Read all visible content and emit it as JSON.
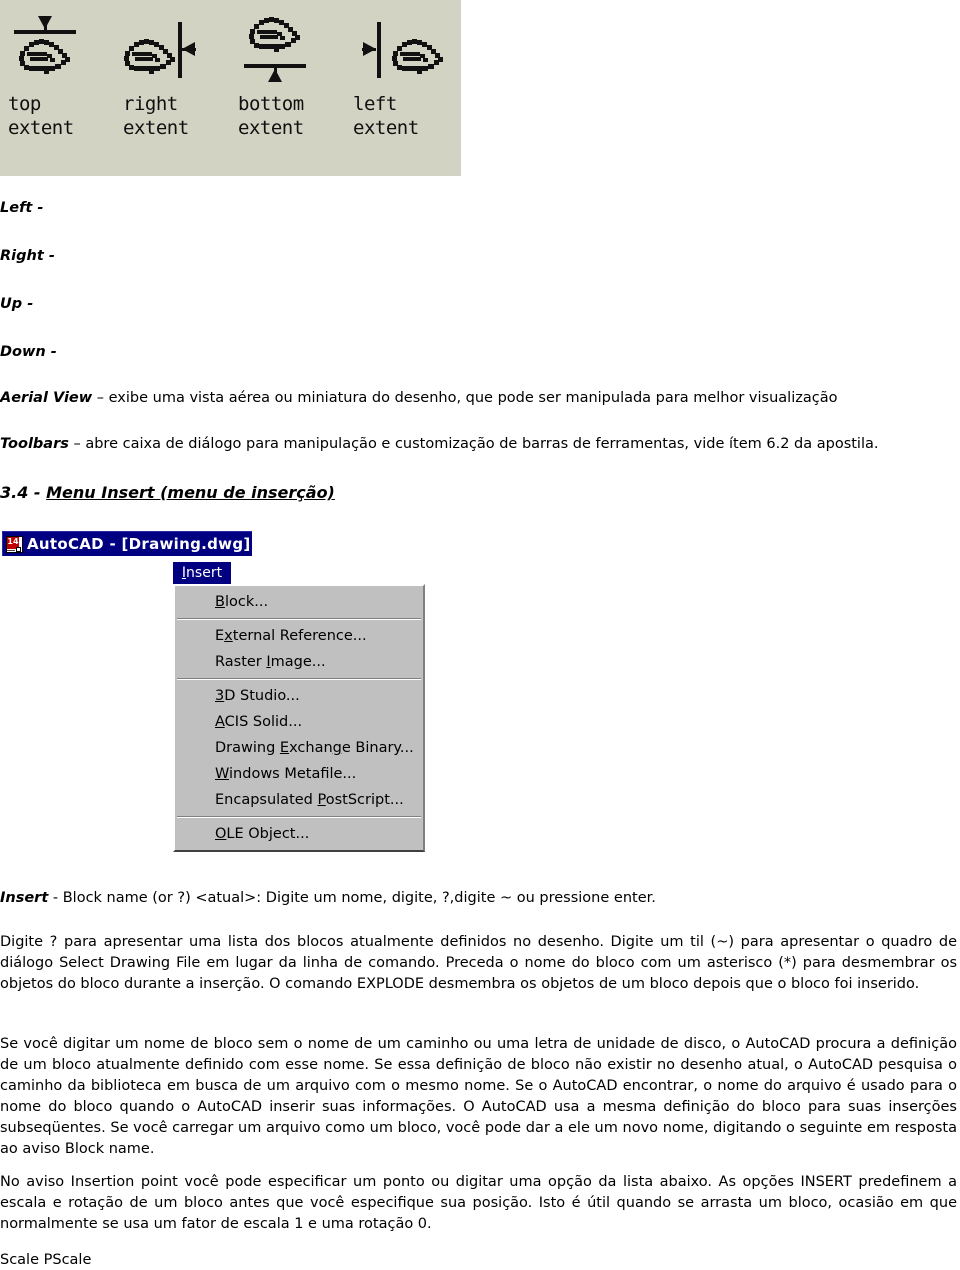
{
  "toolbar_image": {
    "name": "aerial-view-toolbar",
    "background": "#d3d3c4",
    "buttons": [
      {
        "icon": "hand-top-extent-icon",
        "label_line1": "top",
        "label_line2": "extent"
      },
      {
        "icon": "hand-right-extent-icon",
        "label_line1": "right",
        "label_line2": "extent"
      },
      {
        "icon": "hand-bottom-extent-icon",
        "label_line1": "bottom",
        "label_line2": "extent"
      },
      {
        "icon": "hand-left-extent-icon",
        "label_line1": "left",
        "label_line2": "extent"
      }
    ]
  },
  "definitions": [
    {
      "term": "Left",
      "dash": "-",
      "body": ""
    },
    {
      "term": "Right",
      "dash": "-",
      "body": ""
    },
    {
      "term": "Up",
      "dash": "-",
      "body": ""
    },
    {
      "term": "Down",
      "dash": "-",
      "body": ""
    }
  ],
  "paragraphs": {
    "aerial_view_term": "Aerial View",
    "aerial_view_body": " – exibe uma vista aérea ou miniatura do desenho, que pode ser manipulada para melhor visualização",
    "toolbars_term": "Toolbars",
    "toolbars_body": " – abre caixa de diálogo para manipulação e customização de barras de ferramentas, vide ítem 6.2 da apostila.",
    "insert_term": "Insert",
    "insert_body": " - Block name (or ?) <atual>: Digite um nome, digite, ?,digite ~ ou pressione enter.",
    "digite_para": "Digite ? para apresentar uma lista dos blocos atualmente definidos no desenho. Digite um til (~) para apresentar o quadro de diálogo Select Drawing File em lugar da linha de comando. Preceda o nome do bloco com um asterisco (*) para desmembrar os objetos do bloco durante a inserção. O comando EXPLODE desmembra os objetos de um bloco depois que o bloco foi inserido.",
    "se_voce_para": "Se você digitar um nome de bloco sem o nome de um caminho ou uma letra de unidade de disco, o AutoCAD procura a definição de um bloco atualmente definido com esse nome. Se essa definição de bloco não existir no desenho atual, o AutoCAD pesquisa o caminho da biblioteca em busca de um arquivo com o mesmo nome. Se o AutoCAD encontrar, o nome do arquivo é usado para o nome do bloco quando o AutoCAD inserir suas informações. O AutoCAD usa a mesma definição do bloco para suas inserções subseqüentes. Se você carregar um arquivo como um bloco, você pode dar a ele um novo nome, digitando o seguinte em resposta ao aviso Block name.",
    "no_aviso_para": "No aviso Insertion point você pode especificar um ponto ou digitar uma opção da lista abaixo. As opções INSERT predefinem a escala e rotação de um bloco antes que você especifique sua posição. Isto é útil quando se arrasta um bloco, ocasião em que normalmente se usa um fator de escala 1 e uma rotação 0.",
    "scale_pscale": "Scale PScale"
  },
  "section_heading": {
    "number": "3.4 - ",
    "title": "Menu Insert (menu de inserção)"
  },
  "autocad_window": {
    "title": "AutoCAD - [Drawing.dwg]",
    "logo_number": "14",
    "titlebar_color": "#000080",
    "menu_bg_color": "#c0c0c0",
    "active_menu_tab": "Insert",
    "menu_groups": [
      {
        "items": [
          {
            "prefix": "B",
            "rest": "lock..."
          }
        ]
      },
      {
        "items": [
          {
            "prefix": "",
            "mid_pre": "E",
            "mid": "x",
            "rest": "ternal Reference..."
          },
          {
            "prefix": "",
            "rest2": "Raster Image..."
          }
        ]
      },
      {
        "items": [
          {
            "prefix": "3",
            "rest": "D Studio..."
          },
          {
            "prefix": "A",
            "rest": "CIS Solid..."
          },
          {
            "prefix": "",
            "rest2": "Drawing Exchange Binary..."
          },
          {
            "prefix": "W",
            "rest": "indows Metafile..."
          },
          {
            "prefix": "",
            "rest2": "Encapsulated PostScript..."
          }
        ]
      },
      {
        "items": [
          {
            "prefix": "O",
            "rest": "LE Object..."
          }
        ]
      }
    ],
    "menu_item_labels": [
      "Block...",
      "External Reference...",
      "Raster Image...",
      "3D Studio...",
      "ACIS Solid...",
      "Drawing Exchange Binary...",
      "Windows Metafile...",
      "Encapsulated PostScript...",
      "OLE Object..."
    ]
  }
}
